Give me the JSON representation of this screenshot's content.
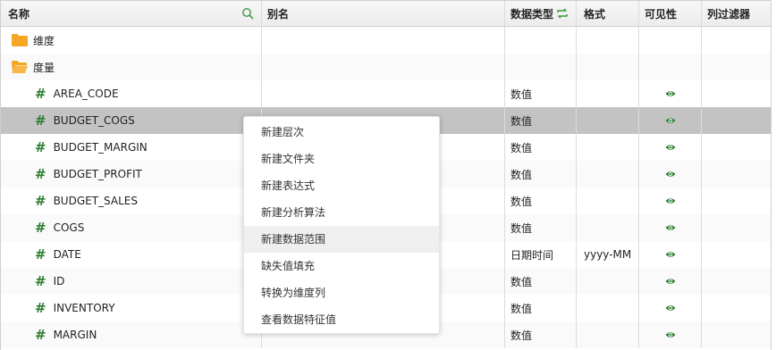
{
  "headers": {
    "name": "名称",
    "alias": "别名",
    "data_type": "数据类型",
    "format": "格式",
    "visible": "可见性",
    "column_filter": "列过滤器"
  },
  "groups": {
    "dimension": "维度",
    "measure": "度量"
  },
  "rows": [
    {
      "name": "AREA_CODE",
      "type": "数值",
      "format": "",
      "visible": true
    },
    {
      "name": "BUDGET_COGS",
      "type": "数值",
      "format": "",
      "visible": true
    },
    {
      "name": "BUDGET_MARGIN",
      "type": "数值",
      "format": "",
      "visible": true
    },
    {
      "name": "BUDGET_PROFIT",
      "type": "数值",
      "format": "",
      "visible": true
    },
    {
      "name": "BUDGET_SALES",
      "type": "数值",
      "format": "",
      "visible": true
    },
    {
      "name": "COGS",
      "type": "数值",
      "format": "",
      "visible": true
    },
    {
      "name": "DATE",
      "type": "日期时间",
      "format": "yyyy-MM",
      "visible": true
    },
    {
      "name": "ID",
      "type": "数值",
      "format": "",
      "visible": true
    },
    {
      "name": "INVENTORY",
      "type": "数值",
      "format": "",
      "visible": true
    },
    {
      "name": "MARGIN",
      "type": "数值",
      "format": "",
      "visible": true
    }
  ],
  "context_menu": {
    "items": [
      "新建层次",
      "新建文件夹",
      "新建表达式",
      "新建分析算法",
      "新建数据范围",
      "缺失值填充",
      "转换为维度列",
      "查看数据特征值"
    ]
  },
  "colors": {
    "folder": "#f5a623",
    "hash": "#2e7d32",
    "eye": "#2e7d32",
    "selected_row": "#c3c3c3",
    "menu_hover": "#efefef"
  },
  "icons": {
    "search": "search-icon",
    "sync": "sync-icon",
    "folder": "folder-icon",
    "measure": "hash-icon",
    "visible": "eye-icon"
  }
}
